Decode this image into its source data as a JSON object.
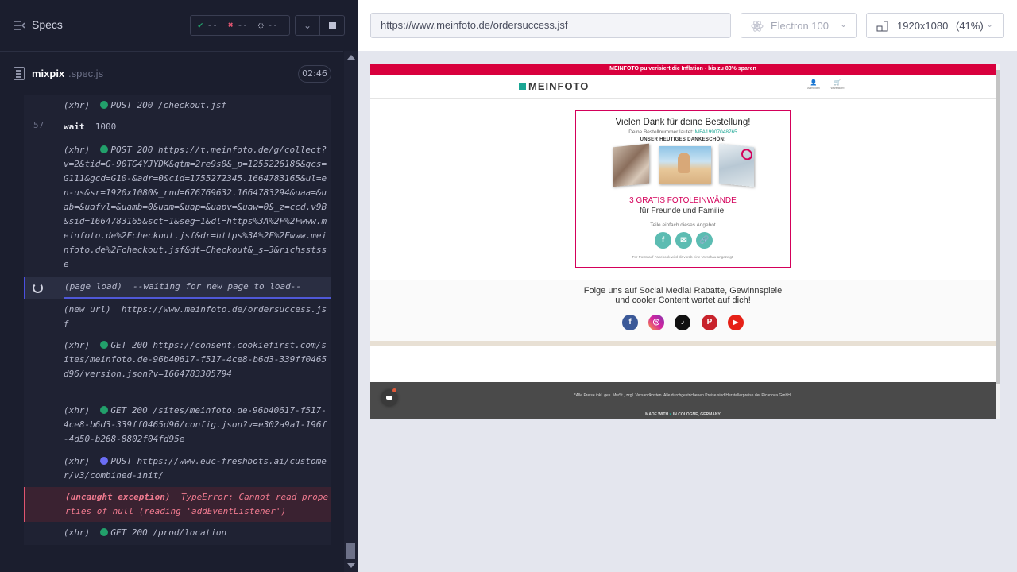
{
  "sidebar": {
    "title": "Specs",
    "stats": {
      "passed": "--",
      "failed": "--",
      "pending": "--"
    },
    "file": {
      "name": "mixpix",
      "ext": ".spec.js",
      "time": "02:46"
    }
  },
  "log": {
    "e1": {
      "prefix": "(xhr)",
      "text": "POST 200 /checkout.jsf"
    },
    "e2": {
      "line": "57",
      "cmd": "wait",
      "arg": "1000"
    },
    "e3": {
      "prefix": "(xhr)",
      "text": "POST 200 https://t.meinfoto.de/g/collect?v=2&tid=G-90TG4YJYDK&gtm=2re9s0&_p=1255226186&gcs=G111&gcd=G10-&adr=0&cid=1755272345.1664783165&ul=en-us&sr=1920x1080&_rnd=676769632.1664783294&uaa=&uab=&uafvl=&uamb=0&uam=&uap=&uapv=&uaw=0&_z=ccd.v9B&sid=1664783165&sct=1&seg=1&dl=https%3A%2F%2Fwww.meinfoto.de%2Fcheckout.jsf&dr=https%3A%2F%2Fwww.meinfoto.de%2Fcheckout.jsf&dt=Checkout&_s=3&richsstsse"
    },
    "e4": {
      "prefix": "(page load)",
      "text": "--waiting for new page to load--"
    },
    "e5": {
      "prefix": "(new url)",
      "text": "https://www.meinfoto.de/ordersuccess.jsf"
    },
    "e6": {
      "prefix": "(xhr)",
      "text": "GET 200 https://consent.cookiefirst.com/sites/meinfoto.de-96b40617-f517-4ce8-b6d3-339ff0465d96/version.json?v=1664783305794"
    },
    "e7": {
      "prefix": "(xhr)",
      "text": "GET 200 /sites/meinfoto.de-96b40617-f517-4ce8-b6d3-339ff0465d96/config.json?v=e302a9a1-196f-4d50-b268-8802f04fd95e"
    },
    "e8": {
      "prefix": "(xhr)",
      "text": "POST https://www.euc-freshbots.ai/customer/v3/combined-init/"
    },
    "e9": {
      "prefix": "(uncaught exception)",
      "text": "TypeError: Cannot read properties of null (reading 'addEventListener')"
    },
    "e10": {
      "prefix": "(xhr)",
      "text": "GET 200 /prod/location"
    }
  },
  "toolbar": {
    "url": "https://www.meinfoto.de/ordersuccess.jsf",
    "browser": "Electron 100",
    "viewport": "1920x1080",
    "zoom": "(41%)"
  },
  "site": {
    "promo": "MEINFOTO pulverisiert die Inflation - bis zu 83% sparen",
    "logo": "MEINFOTO",
    "account_label": "Anmelden",
    "cart_label": "Warenkorb",
    "thanks_title": "Vielen Dank für deine Bestellung!",
    "order_label": "Deine Bestellnummer lautet:",
    "order_number": "MFA19907048765",
    "gift_heading": "UNSER HEUTIGES DANKESCHÖN:",
    "offer_line1": "3 GRATIS FOTOLEINWÄNDE",
    "offer_line2": "für Freunde und Familie!",
    "share_label": "Teile einfach dieses Angebot",
    "share_note": "Für Posts auf Facebook wird dir vorab eine Vorschau angezeigt.",
    "social_title1": "Folge uns auf Social Media! Rabatte, Gewinnspiele",
    "social_title2": "und cooler Content wartet auf dich!",
    "footer_note": "*Alle Preise inkl. ges. MwSt., zzgl. Versandkosten. Alle durchgestrichenen Preise sind Herstellerpreise der Picanova GmbH.",
    "made_in_prefix": "MADE WITH",
    "made_in_suffix": "IN COLOGNE, GERMANY"
  },
  "colors": {
    "accent": "#4f58d8",
    "pass": "#22a06b",
    "fail": "#e05570",
    "brand": "#d8003d",
    "teal": "#1aa694"
  },
  "icons": {
    "facebook": "f",
    "instagram": "◎",
    "tiktok": "♪",
    "pinterest": "P",
    "youtube": "▶"
  }
}
